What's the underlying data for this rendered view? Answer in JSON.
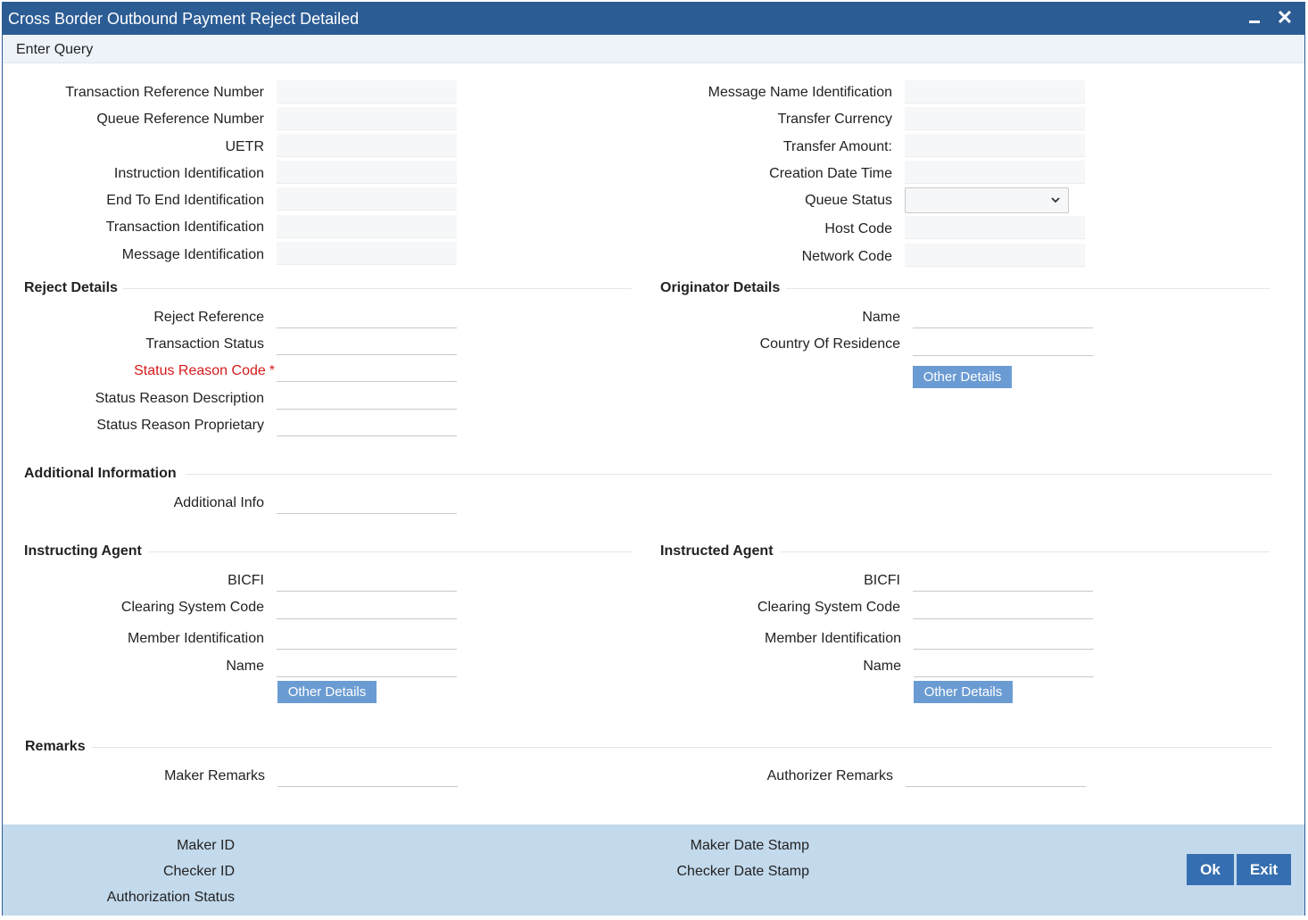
{
  "window": {
    "title": "Cross Border Outbound Payment Reject Detailed",
    "close_glyph": "✕"
  },
  "menu": {
    "enter_query": "Enter Query"
  },
  "header_left": {
    "transaction_reference_number": "Transaction Reference Number",
    "queue_reference_number": "Queue Reference Number",
    "uetr": "UETR",
    "instruction_identification": "Instruction Identification",
    "end_to_end_identification": "End To End Identification",
    "transaction_identification": "Transaction Identification",
    "message_identification": "Message Identification"
  },
  "header_right": {
    "message_name_identification": "Message Name Identification",
    "transfer_currency": "Transfer Currency",
    "transfer_amount": "Transfer Amount:",
    "creation_date_time": "Creation Date Time",
    "queue_status": "Queue Status",
    "host_code": "Host Code",
    "network_code": "Network Code"
  },
  "reject_details": {
    "title": "Reject Details",
    "reject_reference": "Reject Reference",
    "transaction_status": "Transaction Status",
    "status_reason_code": "Status Reason Code",
    "required_marker": "*",
    "status_reason_description": "Status Reason Description",
    "status_reason_proprietary": "Status Reason Proprietary"
  },
  "originator_details": {
    "title": "Originator Details",
    "name": "Name",
    "country_of_residence": "Country Of Residence",
    "other_details": "Other Details"
  },
  "additional_information": {
    "title": "Additional Information",
    "additional_info": "Additional Info"
  },
  "instructing_agent": {
    "title": "Instructing Agent",
    "bicfi": "BICFI",
    "clearing_system_code": "Clearing System Code",
    "member_identification": "Member Identification",
    "name": "Name",
    "other_details": "Other Details"
  },
  "instructed_agent": {
    "title": "Instructed Agent",
    "bicfi": "BICFI",
    "clearing_system_code": "Clearing System Code",
    "member_identification": "Member Identification",
    "name": "Name",
    "other_details": "Other Details"
  },
  "remarks": {
    "title": "Remarks",
    "maker_remarks": "Maker Remarks",
    "authorizer_remarks": "Authorizer Remarks"
  },
  "footer": {
    "maker_id": "Maker ID",
    "checker_id": "Checker ID",
    "authorization_status": "Authorization Status",
    "maker_date_stamp": "Maker Date Stamp",
    "checker_date_stamp": "Checker Date Stamp",
    "ok": "Ok",
    "exit": "Exit"
  },
  "colors": {
    "titlebar": "#2c5c94",
    "footer": "#c3d9ec",
    "secondary_button": "#6b9bd3",
    "primary_button": "#356fb1",
    "required": "#d61a1a"
  }
}
